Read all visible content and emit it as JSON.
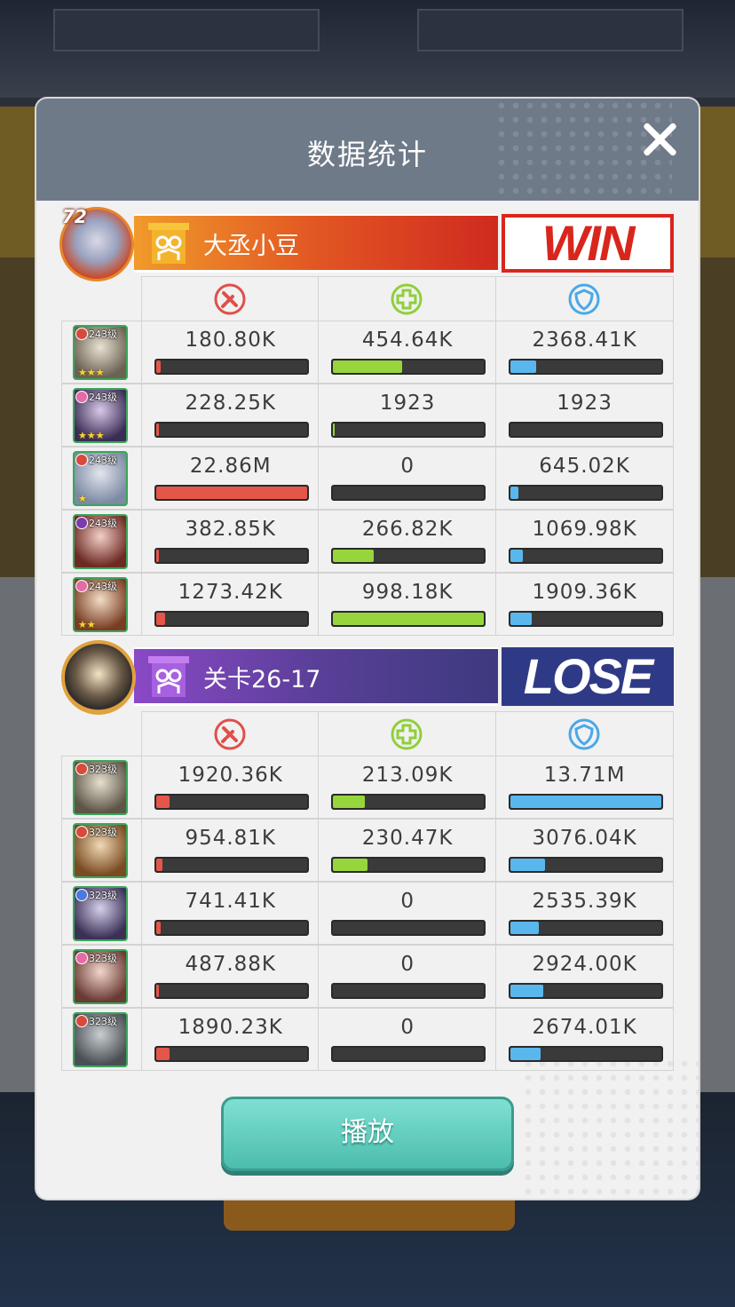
{
  "dialog": {
    "title": "数据统计",
    "play_label": "播放"
  },
  "icons": {
    "damage": "sword-damage-icon",
    "heal": "cross-heal-icon",
    "shield": "shield-icon",
    "close": "close-icon"
  },
  "colors": {
    "damage": "#e4564a",
    "heal": "#96d63c",
    "shield": "#5ab7ee",
    "win": "#d9261d",
    "lose": "#2f3a86"
  },
  "teams": [
    {
      "name": "大丞小豆",
      "result": "WIN",
      "player_level": "72",
      "heroes": [
        {
          "level": "243级",
          "stars": "★★★",
          "damage": "180.80K",
          "heal": "454.64K",
          "shield": "2368.41K",
          "damage_pct": 0.03,
          "heal_pct": 0.46,
          "shield_pct": 0.17
        },
        {
          "level": "243级",
          "stars": "★★★",
          "damage": "228.25K",
          "heal": "1923",
          "shield": "1923",
          "damage_pct": 0.02,
          "heal_pct": 0.01,
          "shield_pct": 0.0
        },
        {
          "level": "243级",
          "stars": "★",
          "damage": "22.86M",
          "heal": "0",
          "shield": "645.02K",
          "damage_pct": 1.0,
          "heal_pct": 0.0,
          "shield_pct": 0.05
        },
        {
          "level": "243级",
          "stars": "",
          "damage": "382.85K",
          "heal": "266.82K",
          "shield": "1069.98K",
          "damage_pct": 0.02,
          "heal_pct": 0.27,
          "shield_pct": 0.08
        },
        {
          "level": "243级",
          "stars": "★★",
          "damage": "1273.42K",
          "heal": "998.18K",
          "shield": "1909.36K",
          "damage_pct": 0.06,
          "heal_pct": 1.0,
          "shield_pct": 0.14
        }
      ]
    },
    {
      "name": "关卡26-17",
      "result": "LOSE",
      "heroes": [
        {
          "level": "323级",
          "stars": "",
          "damage": "1920.36K",
          "heal": "213.09K",
          "shield": "13.71M",
          "damage_pct": 0.09,
          "heal_pct": 0.21,
          "shield_pct": 1.0
        },
        {
          "level": "323级",
          "stars": "",
          "damage": "954.81K",
          "heal": "230.47K",
          "shield": "3076.04K",
          "damage_pct": 0.04,
          "heal_pct": 0.23,
          "shield_pct": 0.23
        },
        {
          "level": "323级",
          "stars": "",
          "damage": "741.41K",
          "heal": "0",
          "shield": "2535.39K",
          "damage_pct": 0.03,
          "heal_pct": 0.0,
          "shield_pct": 0.19
        },
        {
          "level": "323级",
          "stars": "",
          "damage": "487.88K",
          "heal": "0",
          "shield": "2924.00K",
          "damage_pct": 0.02,
          "heal_pct": 0.0,
          "shield_pct": 0.22
        },
        {
          "level": "323级",
          "stars": "",
          "damage": "1890.23K",
          "heal": "0",
          "shield": "2674.01K",
          "damage_pct": 0.09,
          "heal_pct": 0.0,
          "shield_pct": 0.2
        }
      ]
    }
  ]
}
